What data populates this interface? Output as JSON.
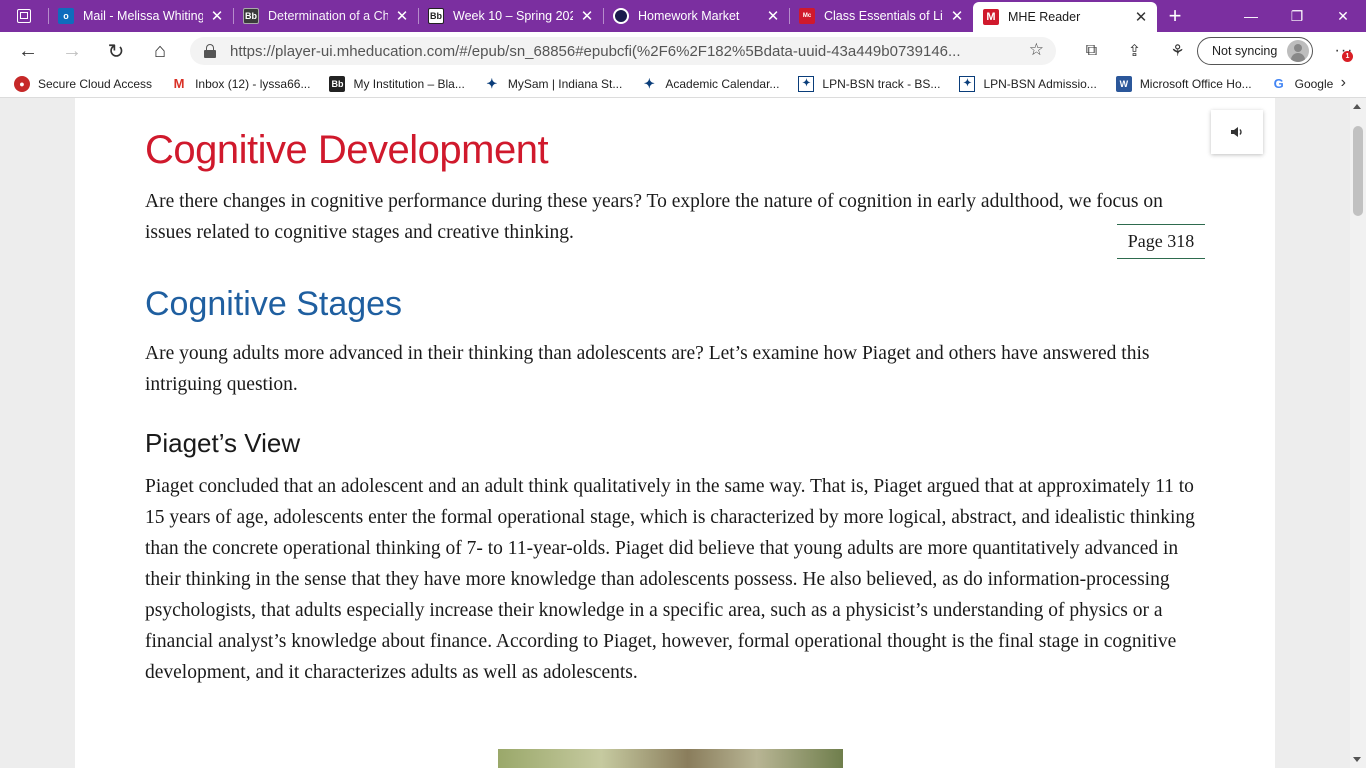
{
  "browser": {
    "tabs": [
      {
        "title": "Mail - Melissa Whiting",
        "icon": "outlook-icon",
        "color": "#0f6cbd"
      },
      {
        "title": "Determination of a Ch",
        "icon": "blackboard-icon",
        "color": "#3a3a3a"
      },
      {
        "title": "Week 10 – Spring 202",
        "icon": "blackboard-icon",
        "color": "#3a3a3a"
      },
      {
        "title": "Homework Market",
        "icon": "homework-market-icon",
        "color": "#1b1b4d"
      },
      {
        "title": "Class Essentials of Life",
        "icon": "mcgraw-hill-icon",
        "color": "#d0192c"
      },
      {
        "title": "MHE Reader",
        "icon": "mhe-reader-icon",
        "color": "#d0192c"
      }
    ],
    "new_tab_label": "+",
    "url": "https://player-ui.mheducation.com/#/epub/sn_68856#epubcfi(%2F6%2F182%5Bdata-uuid-43a449b0739146...",
    "sync_label": "Not syncing",
    "menu_badge": "1",
    "favorites": [
      {
        "label": "Secure Cloud Access",
        "icon": "citrix-icon"
      },
      {
        "label": "Inbox (12) - lyssa66...",
        "icon": "gmail-icon"
      },
      {
        "label": "My Institution – Bla...",
        "icon": "blackboard-icon"
      },
      {
        "label": "MySam | Indiana St...",
        "icon": "sycamore-icon"
      },
      {
        "label": "Academic Calendar...",
        "icon": "sycamore-icon"
      },
      {
        "label": "LPN-BSN track - BS...",
        "icon": "isu-icon"
      },
      {
        "label": "LPN-BSN Admissio...",
        "icon": "isu-icon"
      },
      {
        "label": "Microsoft Office Ho...",
        "icon": "word-icon"
      },
      {
        "label": "Google",
        "icon": "google-icon"
      }
    ]
  },
  "document": {
    "heading": "Cognitive Development",
    "intro": "Are there changes in cognitive performance during these years? To explore the nature of cognition in early adulthood, we focus on issues related to cognitive stages and creative thinking.",
    "page_marker": "Page 318",
    "subheading": "Cognitive Stages",
    "stages_intro": "Are young adults more advanced in their thinking than adolescents are? Let’s examine how Piaget and others have answered this intriguing question.",
    "section_heading": "Piaget’s View",
    "piaget_paragraph": "Piaget concluded that an adolescent and an adult think qualitatively in the same way. That is, Piaget argued that at approximately 11 to 15 years of age, adolescents enter the formal operational stage, which is characterized by more logical, abstract, and idealistic thinking than the concrete operational thinking of 7- to 11-year-olds. Piaget did believe that young adults are more quantitatively advanced in their thinking in the sense that they have more knowledge than adolescents possess. He also believed, as do information-processing psychologists, that adults especially increase their knowledge in a specific area, such as a physicist’s understanding of physics or a financial analyst’s knowledge about finance. According to Piaget, however, formal operational thought is the final stage in cognitive development, and it characterizes adults as well as adolescents."
  },
  "colors": {
    "tab_strip": "#7b2fa0",
    "heading_red": "#d0192c",
    "subheading_blue": "#1f5fa0",
    "page_marker_rule": "#2e6b4e"
  }
}
